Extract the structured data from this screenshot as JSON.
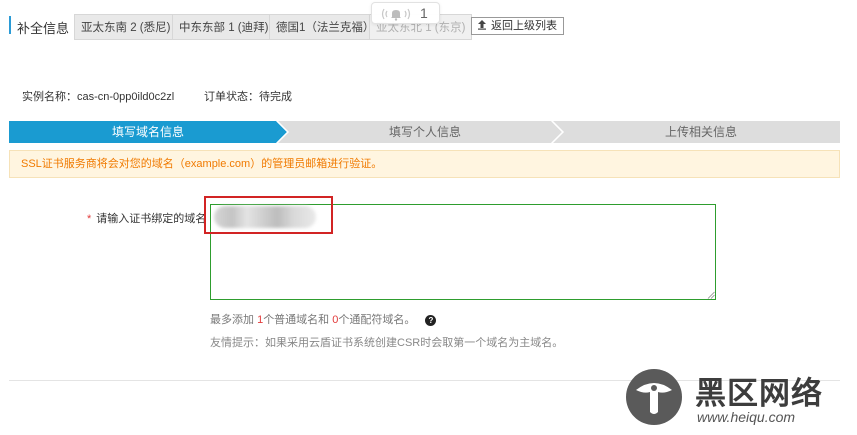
{
  "header": {
    "section_title": "补全信息",
    "region_tabs": [
      "亚太东南 2 (悉尼)",
      "中东东部 1 (迪拜)",
      "德国1（法兰克福）",
      "亚太东北 1 (东京)"
    ],
    "notification_count": "1",
    "back_button_label": "返回上级列表"
  },
  "info": {
    "instance_label": "实例名称：cas-cn-0pp0ild0c2zl",
    "order_status_label": "订单状态：待完成"
  },
  "stepper": {
    "steps": [
      "填写域名信息",
      "填写个人信息",
      "上传相关信息"
    ],
    "active_index": 0,
    "active_color": "#1a9bd1",
    "inactive_color": "#dddddd"
  },
  "notice": {
    "text": "SSL证书服务商将会对您的域名（example.com）的管理员邮箱进行验证。"
  },
  "form": {
    "required_mark": "*",
    "domain_label": "请输入证书绑定的域名",
    "domain_value": "",
    "hint_prefix": "最多添加 ",
    "hint_count_normal": "1",
    "hint_middle": "个普通域名和 ",
    "hint_count_wildcard": "0",
    "hint_suffix": "个通配符域名。",
    "help_glyph": "?",
    "tip": "友情提示：如果采用云盾证书系统创建CSR时会取第一个域名为主域名。"
  },
  "watermark": {
    "title": "黑区网络",
    "url": "www.heiqu.com"
  },
  "colors": {
    "accent_blue": "#1a9bd1",
    "notice_text": "#f07a00",
    "notice_bg": "#fff5e0",
    "input_border": "#2e9d2e",
    "highlight_red": "#d22424"
  }
}
